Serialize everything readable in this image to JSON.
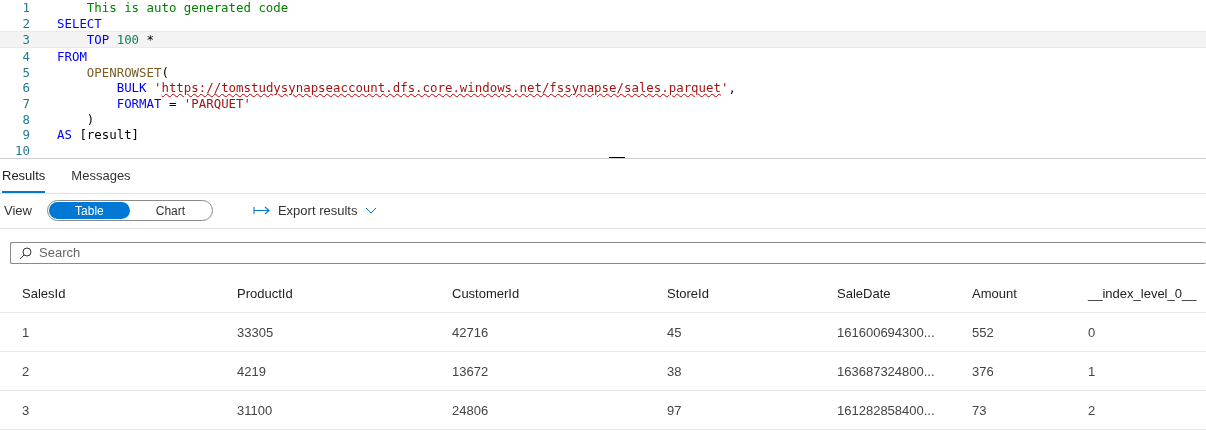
{
  "editor": {
    "lines": [
      {
        "number": "1",
        "current": false,
        "tokens": [
          {
            "kind": "comment",
            "text": "    This is auto generated code"
          }
        ]
      },
      {
        "number": "2",
        "current": false,
        "tokens": [
          {
            "kind": "keyword",
            "text": "SELECT"
          }
        ]
      },
      {
        "number": "3",
        "current": true,
        "tokens": [
          {
            "kind": "keyword",
            "text": "    TOP"
          },
          {
            "kind": "number",
            "text": " 100"
          },
          {
            "kind": "plain",
            "text": " *"
          }
        ]
      },
      {
        "number": "4",
        "current": false,
        "tokens": [
          {
            "kind": "keyword",
            "text": "FROM"
          }
        ]
      },
      {
        "number": "5",
        "current": false,
        "tokens": [
          {
            "kind": "function",
            "text": "    OPENROWSET"
          },
          {
            "kind": "plain",
            "text": "("
          }
        ]
      },
      {
        "number": "6",
        "current": false,
        "tokens": [
          {
            "kind": "keyword",
            "text": "        BULK"
          },
          {
            "kind": "string",
            "text": " '"
          },
          {
            "kind": "url",
            "text": "https://tomstudysynapseaccount.dfs.core.windows.net/fssynapse/sales.parquet"
          },
          {
            "kind": "string",
            "text": "'"
          },
          {
            "kind": "plain",
            "text": ","
          }
        ]
      },
      {
        "number": "7",
        "current": false,
        "tokens": [
          {
            "kind": "keyword",
            "text": "        FORMAT"
          },
          {
            "kind": "plain",
            "text": " = "
          },
          {
            "kind": "string",
            "text": "'PARQUET'"
          }
        ]
      },
      {
        "number": "8",
        "current": false,
        "tokens": [
          {
            "kind": "plain",
            "text": "    )"
          }
        ]
      },
      {
        "number": "9",
        "current": false,
        "tokens": [
          {
            "kind": "keyword",
            "text": "AS"
          },
          {
            "kind": "plain",
            "text": " [result]"
          }
        ]
      },
      {
        "number": "10",
        "current": false
      }
    ]
  },
  "tabs": [
    {
      "label": "Results",
      "selected": true
    },
    {
      "label": "Messages",
      "selected": false
    }
  ],
  "view": {
    "label": "View",
    "options": [
      {
        "label": "Table",
        "selected": true
      },
      {
        "label": "Chart",
        "selected": false
      }
    ]
  },
  "export": {
    "label": "Export results"
  },
  "search": {
    "placeholder": "Search"
  },
  "table": {
    "columns": [
      "SalesId",
      "ProductId",
      "CustomerId",
      "StoreId",
      "SaleDate",
      "Amount",
      "__index_level_0__"
    ],
    "rows": [
      [
        "1",
        "33305",
        "42716",
        "45",
        "161600694300...",
        "552",
        "0"
      ],
      [
        "2",
        "4219",
        "13672",
        "38",
        "163687324800...",
        "376",
        "1"
      ],
      [
        "3",
        "31100",
        "24806",
        "97",
        "161282858400...",
        "73",
        "2"
      ]
    ]
  }
}
